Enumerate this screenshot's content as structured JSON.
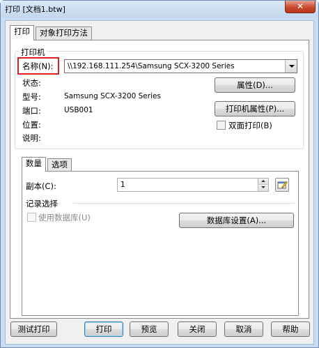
{
  "window": {
    "title": "打印 [文档1.btw]",
    "close_symbol": "✕"
  },
  "tabs": [
    {
      "label": "打印",
      "active": true
    },
    {
      "label": "对象打印方法",
      "active": false
    }
  ],
  "printer": {
    "group_label": "打印机",
    "name_label": "名称(N):",
    "name_value": "\\\\192.168.111.254\\Samsung SCX-3200 Series",
    "status_label": "状态:",
    "status_value": "",
    "model_label": "型号:",
    "model_value": "Samsung SCX-3200 Series",
    "port_label": "端口:",
    "port_value": "USB001",
    "location_label": "位置:",
    "location_value": "",
    "comment_label": "说明:",
    "comment_value": "",
    "properties_button": "属性(D)...",
    "printer_properties_button": "打印机属性(P)...",
    "duplex_label": "双面打印(B)",
    "duplex_checked": false
  },
  "subtabs": [
    {
      "label": "数量",
      "active": true
    },
    {
      "label": "选项",
      "active": false
    }
  ],
  "quantity": {
    "copies_label": "副本(C):",
    "copies_value": "1",
    "record_selection_label": "记录选择",
    "use_database_label": "使用数据库(U)",
    "use_database_checked": false,
    "use_database_enabled": false,
    "database_settings_button": "数据库设置(A)..."
  },
  "footer": {
    "test_print": "测试打印",
    "print": "打印",
    "preview": "预览",
    "close": "关闭",
    "cancel": "取消",
    "help": "帮助"
  },
  "colors": {
    "highlight_border": "#e02020",
    "window_frame": "#c9dcf2",
    "default_button_border": "#3c7fb1"
  }
}
